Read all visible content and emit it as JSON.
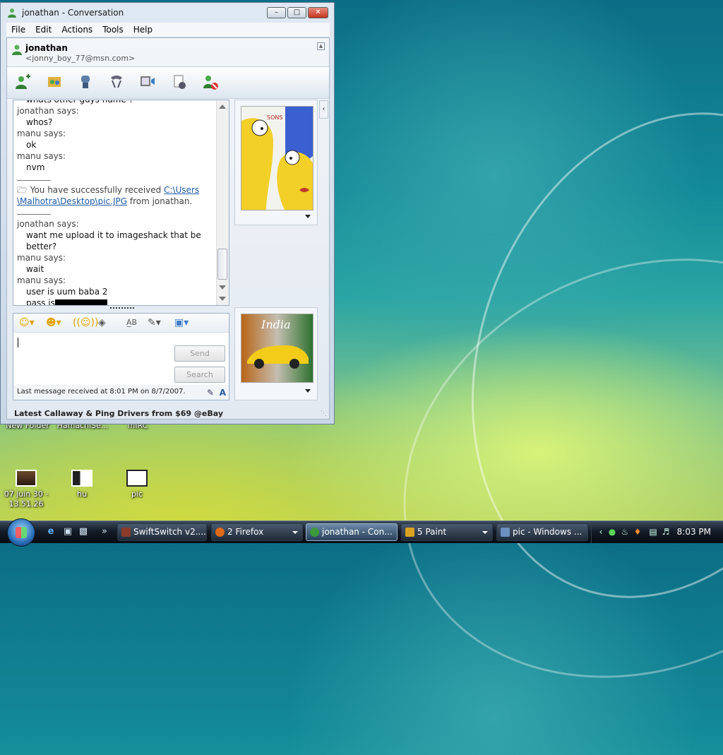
{
  "window": {
    "title": "jonathan - Conversation",
    "menu": [
      "File",
      "Edit",
      "Actions",
      "Tools",
      "Help"
    ],
    "contact_name": "jonathan",
    "contact_email": "<jonny_boy_77@msn.com>"
  },
  "toolbar_icons": [
    "invite-contact-icon",
    "share-files-icon",
    "voice-call-icon",
    "phone-call-icon",
    "video-call-icon",
    "games-icon",
    "block-contact-icon"
  ],
  "chat": {
    "lines": [
      {
        "kind": "msg",
        "text": "whats other guys name ?"
      },
      {
        "kind": "sender",
        "text": "jonathan says:"
      },
      {
        "kind": "msg",
        "text": "whos?"
      },
      {
        "kind": "sender",
        "text": "manu says:"
      },
      {
        "kind": "msg",
        "text": "ok"
      },
      {
        "kind": "sender",
        "text": "manu says:"
      },
      {
        "kind": "msg",
        "text": "nvm"
      },
      {
        "kind": "rule",
        "text": ""
      },
      {
        "kind": "transfer",
        "text": "You have successfully received ",
        "link1": "C:\\Users",
        "link2": "\\Malhotra\\Desktop\\pic.JPG",
        "tail": " from jonathan."
      },
      {
        "kind": "rule",
        "text": ""
      },
      {
        "kind": "sender",
        "text": "jonathan says:"
      },
      {
        "kind": "msg",
        "text": "want me upload it to imageshack that be"
      },
      {
        "kind": "msg",
        "text": "better?"
      },
      {
        "kind": "sender",
        "text": "manu says:"
      },
      {
        "kind": "msg",
        "text": "wait"
      },
      {
        "kind": "sender",
        "text": "manu says:"
      },
      {
        "kind": "msg",
        "text": "user is uum baba 2"
      },
      {
        "kind": "msg",
        "text": "pass is"
      }
    ]
  },
  "editor": {
    "send_label": "Send",
    "search_label": "Search",
    "status_text": "Last message received at 8:01 PM on 8/7/2007."
  },
  "display_pictures": {
    "top_text": "SONS",
    "bottom_text": "India"
  },
  "ad_text": "Latest Callaway & Ping Drivers from $69 @eBay",
  "desktop_icons": [
    {
      "label": "New Folder"
    },
    {
      "label": "HamachiSe..."
    },
    {
      "label": "mIRC"
    },
    {
      "label": "07 juin 30 - 13.51.26"
    },
    {
      "label": "hu"
    },
    {
      "label": "pic"
    }
  ],
  "taskbar": {
    "buttons": [
      {
        "label": "SwiftSwitch v2....",
        "color": "#8a3b2b"
      },
      {
        "label": "2 Firefox",
        "color": "#e06a1c"
      },
      {
        "label": "jonathan - Con...",
        "color": "#3a9a3a"
      },
      {
        "label": "5 Paint",
        "color": "#d9a321"
      },
      {
        "label": "pic - Windows ...",
        "color": "#6a8fc0"
      }
    ],
    "clock": "8:03 PM"
  }
}
